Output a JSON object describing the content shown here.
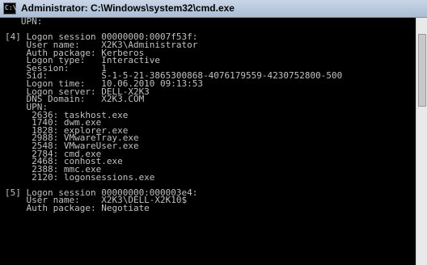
{
  "window": {
    "title": "Administrator: C:\\Windows\\system32\\cmd.exe",
    "icon_label": "C:\\"
  },
  "console": {
    "lines": [
      "   UPN:",
      "",
      "[4] Logon session 00000000:0007f53f:",
      "    User name:    X2K3\\Administrator",
      "    Auth package: Kerberos",
      "    Logon type:   Interactive",
      "    Session:      1",
      "    Sid:          S-1-5-21-3865300868-4076179559-4230752800-500",
      "    Logon time:   10.06.2010 09:13:53",
      "    Logon server: DELL-X2K3",
      "    DNS Domain:   X2K3.COM",
      "    UPN:",
      "     2636: taskhost.exe",
      "     1740: dwm.exe",
      "     1828: explorer.exe",
      "     2988: VMwareTray.exe",
      "     2548: VMwareUser.exe",
      "     2784: cmd.exe",
      "     2468: conhost.exe",
      "     2388: mmc.exe",
      "     2120: logonsessions.exe",
      "",
      "[5] Logon session 00000000:000003e4:",
      "    User name:    X2K3\\DELL-X2K10$",
      "    Auth package: Negotiate"
    ]
  }
}
